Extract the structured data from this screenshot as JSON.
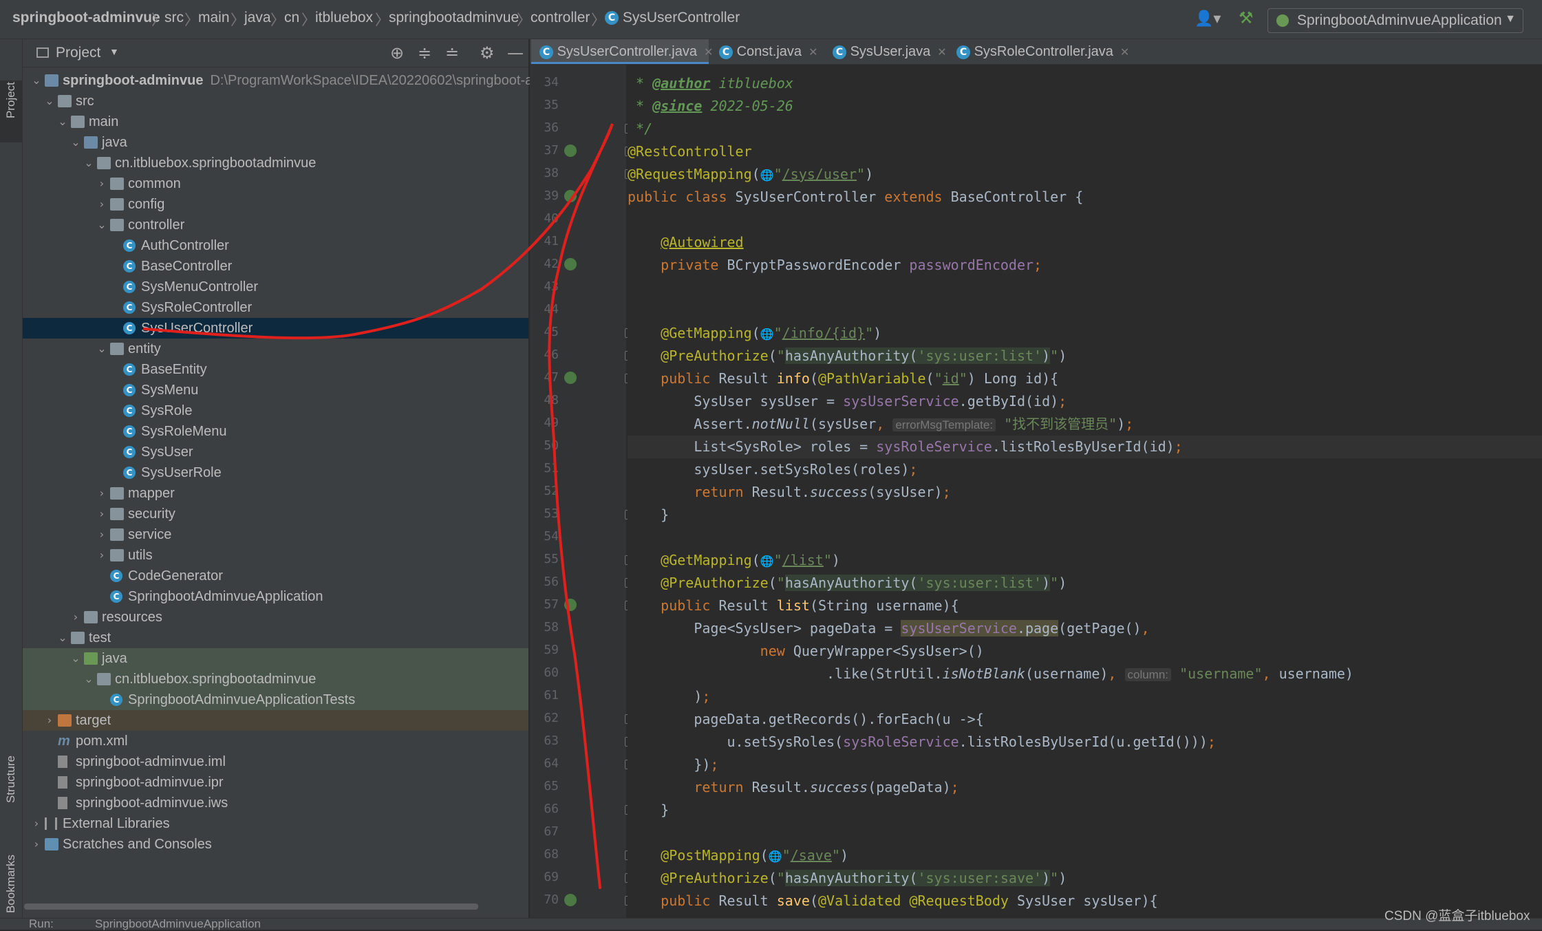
{
  "breadcrumb": {
    "items": [
      "springboot-adminvue",
      "src",
      "main",
      "java",
      "cn",
      "itbluebox",
      "springbootadminvue",
      "controller",
      "SysUserController"
    ]
  },
  "toolbar": {
    "run_config": "SpringbootAdminvueApplication"
  },
  "side_tabs": {
    "project": "Project",
    "structure": "Structure",
    "bookmarks": "Bookmarks"
  },
  "project_panel": {
    "title": "Project",
    "tree": [
      {
        "label": "springboot-adminvue",
        "path": "D:\\ProgramWorkSpace\\IDEA\\20220602\\springboot-a"
      },
      {
        "label": "src"
      },
      {
        "label": "main"
      },
      {
        "label": "java"
      },
      {
        "label": "cn.itbluebox.springbootadminvue"
      },
      {
        "label": "common"
      },
      {
        "label": "config"
      },
      {
        "label": "controller"
      },
      {
        "label": "AuthController"
      },
      {
        "label": "BaseController"
      },
      {
        "label": "SysMenuController"
      },
      {
        "label": "SysRoleController"
      },
      {
        "label": "SysUserController"
      },
      {
        "label": "entity"
      },
      {
        "label": "BaseEntity"
      },
      {
        "label": "SysMenu"
      },
      {
        "label": "SysRole"
      },
      {
        "label": "SysRoleMenu"
      },
      {
        "label": "SysUser"
      },
      {
        "label": "SysUserRole"
      },
      {
        "label": "mapper"
      },
      {
        "label": "security"
      },
      {
        "label": "service"
      },
      {
        "label": "utils"
      },
      {
        "label": "CodeGenerator"
      },
      {
        "label": "SpringbootAdminvueApplication"
      },
      {
        "label": "resources"
      },
      {
        "label": "test"
      },
      {
        "label": "java"
      },
      {
        "label": "cn.itbluebox.springbootadminvue"
      },
      {
        "label": "SpringbootAdminvueApplicationTests"
      },
      {
        "label": "target"
      },
      {
        "label": "pom.xml"
      },
      {
        "label": "springboot-adminvue.iml"
      },
      {
        "label": "springboot-adminvue.ipr"
      },
      {
        "label": "springboot-adminvue.iws"
      },
      {
        "label": "External Libraries"
      },
      {
        "label": "Scratches and Consoles"
      }
    ]
  },
  "editor": {
    "tabs": [
      "SysUserController.java",
      "Const.java",
      "SysUser.java",
      "SysRoleController.java"
    ],
    "line_numbers": [
      "34",
      "35",
      "36",
      "37",
      "38",
      "39",
      "40",
      "41",
      "42",
      "43",
      "44",
      "45",
      "46",
      "47",
      "48",
      "49",
      "50",
      "51",
      "52",
      "53",
      "54",
      "55",
      "56",
      "57",
      "58",
      "59",
      "60",
      "61",
      "62",
      "63",
      "64",
      "65",
      "66",
      "67",
      "68",
      "69",
      "70"
    ],
    "code_text": {
      "author_tag": "@author",
      "author": "itbluebox",
      "since_tag": "@since",
      "since": "2022-05-26",
      "rest_controller": "@RestController",
      "request_mapping": "@RequestMapping",
      "sys_user_path": "/sys/user",
      "class_name": "SysUserController",
      "base_class": "BaseController",
      "autowired": "@Autowired",
      "encoder_type": "BCryptPasswordEncoder",
      "encoder_field": "passwordEncoder",
      "get_mapping": "@GetMapping",
      "info_path": "/info/{id}",
      "pre_authorize": "@PreAuthorize",
      "perm_list": "'sys:user:list'",
      "perm_save": "'sys:user:save'",
      "has_any_authority": "hasAnyAuthority(",
      "path_variable": "@PathVariable",
      "id_param": "id",
      "error_hint": "errorMsgTemplate:",
      "error_msg": "\"找不到该管理员\"",
      "list_path": "/list",
      "column_hint": "column:",
      "username_str": "\"username\"",
      "post_mapping": "@PostMapping",
      "save_path": "/save",
      "validated": "@Validated",
      "request_body": "@RequestBody"
    }
  },
  "bottom": {
    "run_label": "Run:",
    "run_app": "SpringbootAdminvueApplication"
  },
  "watermark": "CSDN @蓝盒子itbluebox",
  "colors": {
    "selection": "#0d293e",
    "annotation_line": "#e0201c",
    "keyword": "#cc7832",
    "annotation": "#bbb529",
    "string": "#6a8759"
  }
}
